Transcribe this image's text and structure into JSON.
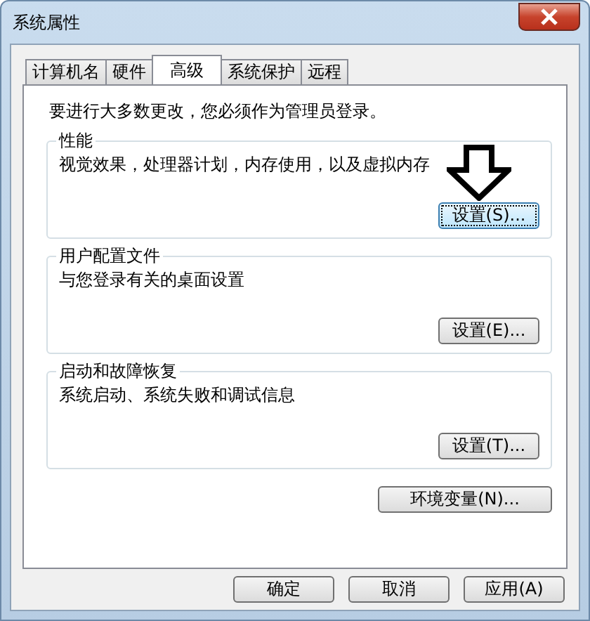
{
  "window": {
    "title": "系统属性"
  },
  "tabs": [
    {
      "label": "计算机名",
      "selected": false
    },
    {
      "label": "硬件",
      "selected": false
    },
    {
      "label": "高级",
      "selected": true
    },
    {
      "label": "系统保护",
      "selected": false
    },
    {
      "label": "远程",
      "selected": false
    }
  ],
  "notice": "要进行大多数更改，您必须作为管理员登录。",
  "groups": [
    {
      "title": "性能",
      "description": "视觉效果，处理器计划，内存使用，以及虚拟内存",
      "button": "设置(S)...",
      "focused": true,
      "arrow": true
    },
    {
      "title": "用户配置文件",
      "description": "与您登录有关的桌面设置",
      "button": "设置(E)...",
      "focused": false,
      "arrow": false
    },
    {
      "title": "启动和故障恢复",
      "description": "系统启动、系统失败和调试信息",
      "button": "设置(T)...",
      "focused": false,
      "arrow": false
    }
  ],
  "env_button": "环境变量(N)...",
  "buttons": [
    "确定",
    "取消",
    "应用(A)"
  ]
}
